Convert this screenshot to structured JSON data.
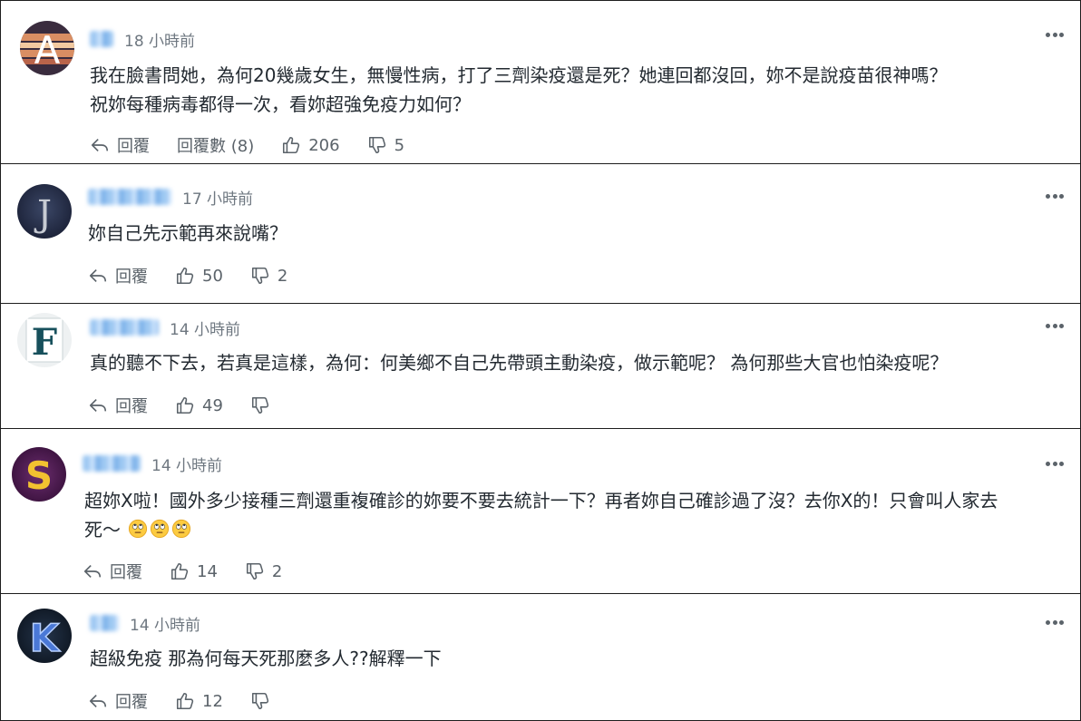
{
  "colors": {
    "text": "#232a31",
    "muted": "#5b636a",
    "border": "#1d1d1d",
    "name_blur": "#9ec8f2"
  },
  "comments": [
    {
      "avatar_letter": "A",
      "time": "18 小時前",
      "text": "我在臉書問她，為何20幾歲女生，無慢性病，打了三劑染疫還是死？她連回都沒回，妳不是說疫苗很神嗎？\n祝妳每種病毒都得一次，看妳超強免疫力如何？",
      "reply_label": "回覆",
      "replies_label": "回覆數 (8)",
      "likes": "206",
      "dislikes": "5"
    },
    {
      "avatar_letter": "J",
      "time": "17 小時前",
      "text": "妳自己先示範再來說嘴？",
      "reply_label": "回覆",
      "likes": "50",
      "dislikes": "2"
    },
    {
      "avatar_letter": "F",
      "time": "14 小時前",
      "text": "真的聽不下去，若真是這樣，為何：何美鄉不自己先帶頭主動染疫，做示範呢？ 為何那些大官也怕染疫呢？",
      "reply_label": "回覆",
      "likes": "49",
      "dislikes": ""
    },
    {
      "avatar_letter": "S",
      "time": "14 小時前",
      "text": "超妳X啦！國外多少接種三劑還重複確診的妳要不要去統計一下？再者妳自己確診過了沒？去你X的！只會叫人家去\n死～",
      "emoji": "eye-roll-face",
      "reply_label": "回覆",
      "likes": "14",
      "dislikes": "2"
    },
    {
      "avatar_letter": "K",
      "time": "14 小時前",
      "text": "超級免疫 那為何每天死那麼多人??解釋一下",
      "reply_label": "回覆",
      "likes": "12",
      "dislikes": ""
    }
  ]
}
